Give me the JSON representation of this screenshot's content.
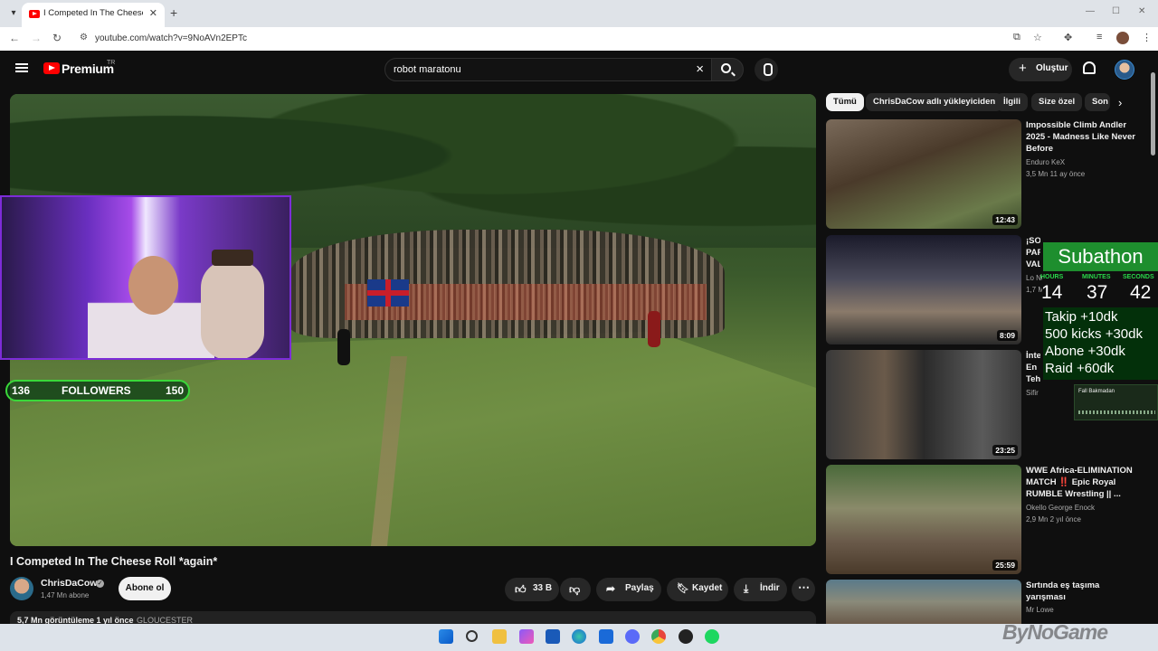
{
  "browser": {
    "tab_title": "I Competed In The Cheese Roll",
    "new_tab": "+",
    "url": "youtube.com/watch?v=9NoAVn2EPTc",
    "controls": {
      "minimize": "—",
      "restore": "☐",
      "close": "✕"
    }
  },
  "youtube": {
    "logo": "Premium",
    "country": "TR",
    "search_value": "robot maratonu",
    "create_label": "Oluştur"
  },
  "video": {
    "title": "I Competed In The Cheese Roll *again*",
    "channel": "ChrisDaCow",
    "subscribers": "1,47 Mn abone",
    "subscribe_label": "Abone ol",
    "likes": "33 B",
    "share": "Paylaş",
    "save": "Kaydet",
    "download": "İndir",
    "views_date": "5,7 Mn görüntüleme  1 yıl önce",
    "location": "GLOUCESTER",
    "overlay_followers": {
      "current": "136",
      "label": "FOLLOWERS",
      "goal": "150"
    }
  },
  "chips": [
    "Tümü",
    "ChrisDaCow adlı yükleyiciden",
    "İlgili",
    "Size özel",
    "Son"
  ],
  "recommendations": [
    {
      "title": "Impossible Climb Andler 2025 - Madness Like Never Before",
      "channel": "Enduro KeX",
      "stats": "3,5 Mn  11 ay önce",
      "duration": "12:43"
    },
    {
      "title": "¡SOLO PARA VALIENTES! JUGANDO AL SUBE Y BAJA CON EL TORO",
      "channel": "Lo Nuevo Jaripeo",
      "stats": "1,7 Mn  7 ay önce",
      "duration": "8:09"
    },
    {
      "title": "İnternetteki En Tehlikeli Görüntülerin En İNANILMAZ EDİCİ Videolar",
      "channel": "Sifir",
      "stats": "",
      "duration": "23:25"
    },
    {
      "title": "WWE Africa-ELIMINATION MATCH ‼️ Epic Royal RUMBLE Wrestling || ...",
      "channel": "Okello George Enock",
      "stats": "2,9 Mn  2 yıl önce",
      "duration": "25:59"
    },
    {
      "title": "Sırtında eş taşıma yarışması",
      "channel": "Mr Lowe",
      "stats": "",
      "duration": ""
    }
  ],
  "subathon": {
    "title": "Subathon",
    "units": [
      "HOURS",
      "MINUTES",
      "SECONDS"
    ],
    "values": [
      "14",
      "37",
      "42"
    ],
    "lines": [
      "Takip +10dk",
      "500 kicks +30dk",
      "Abone +30dk",
      "Raid +60dk"
    ],
    "player_label": "Fall Bakmadan"
  },
  "watermark": "ByNoGame",
  "colors": {
    "youtube_red": "#ff0000",
    "subathon_green": "#1e8e2e",
    "followers_border": "#3ad83a"
  }
}
